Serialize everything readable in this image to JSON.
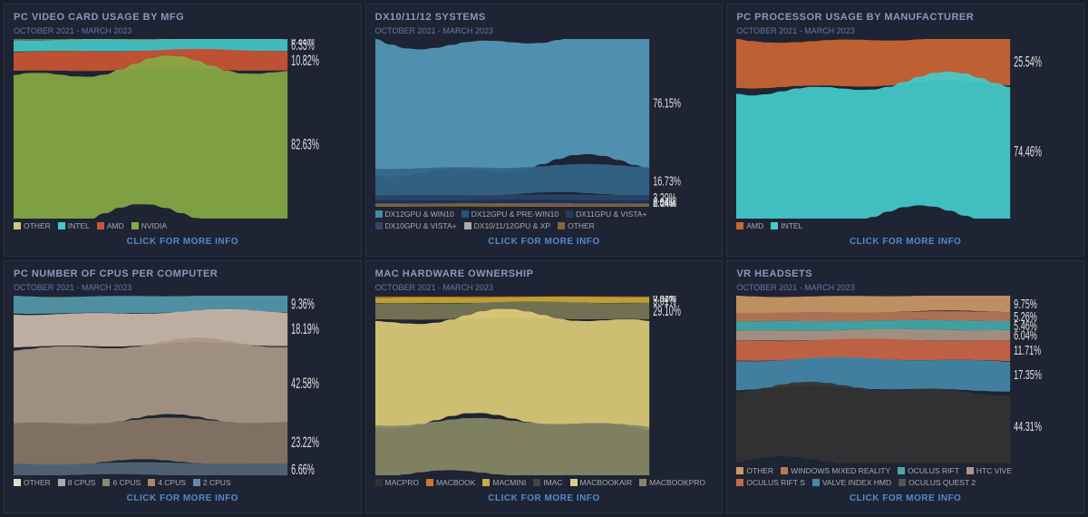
{
  "panels": [
    {
      "id": "pc-video-card",
      "title": "PC VIDEO CARD USAGE BY MFG",
      "period": "OCTOBER 2021 - MARCH 2023",
      "click_label": "CLICK FOR MORE INFO",
      "legend": [
        {
          "label": "OTHER",
          "color": "#d4c878"
        },
        {
          "label": "INTEL",
          "color": "#45c8c8"
        },
        {
          "label": "AMD",
          "color": "#cc5533"
        },
        {
          "label": "NVIDIA",
          "color": "#88aa44"
        }
      ],
      "percentages": [
        "0.22%",
        "6.33%",
        "10.82%",
        "82.63%"
      ],
      "pct_colors": [
        "#d4c878",
        "#45c8c8",
        "#cc5533",
        "#88aa44"
      ],
      "layers": [
        {
          "color": "#d4c878",
          "pct": 0.22
        },
        {
          "color": "#45c8c8",
          "pct": 6.33
        },
        {
          "color": "#cc5533",
          "pct": 10.82
        },
        {
          "color": "#88aa44",
          "pct": 82.63
        }
      ]
    },
    {
      "id": "dx-systems",
      "title": "DX10/11/12 SYSTEMS",
      "period": "OCTOBER 2021 - MARCH 2023",
      "click_label": "CLICK FOR MORE INFO",
      "legend": [
        {
          "label": "DX12GPU & WIN10",
          "color": "#4488aa"
        },
        {
          "label": "DX12GPU & PRE-WIN10",
          "color": "#225577"
        },
        {
          "label": "DX11GPU & VISTA+",
          "color": "#2a3a55"
        },
        {
          "label": "DX10GPU & VISTA+",
          "color": "#334466"
        },
        {
          "label": "DX10/11/12GPU & XP",
          "color": "#aaaaaa"
        },
        {
          "label": "OTHER",
          "color": "#886644"
        }
      ],
      "percentages": [
        "76.15%",
        "16.73%",
        "3.29%",
        "2.04%",
        "0.26%",
        "1.53%"
      ],
      "pct_colors": [
        "#cccccc",
        "#cccccc",
        "#cccccc",
        "#cccccc",
        "#cccccc",
        "#cccccc"
      ],
      "layers": [
        {
          "color": "#5599bb",
          "pct": 76.15
        },
        {
          "color": "#336688",
          "pct": 16.73
        },
        {
          "color": "#2a4466",
          "pct": 3.29
        },
        {
          "color": "#223355",
          "pct": 2.04
        },
        {
          "color": "#cccccc",
          "pct": 0.26
        },
        {
          "color": "#886633",
          "pct": 1.53
        }
      ]
    },
    {
      "id": "pc-processor",
      "title": "PC PROCESSOR USAGE BY MANUFACTURER",
      "period": "OCTOBER 2021 - MARCH 2023",
      "click_label": "CLICK FOR MORE INFO",
      "legend": [
        {
          "label": "AMD",
          "color": "#cc6633"
        },
        {
          "label": "INTEL",
          "color": "#44cccc"
        }
      ],
      "percentages": [
        "25.54%",
        "74.46%"
      ],
      "pct_colors": [
        "#cc6633",
        "#44cccc"
      ],
      "layers": [
        {
          "color": "#cc6633",
          "pct": 25.54
        },
        {
          "color": "#44cccc",
          "pct": 74.46
        }
      ]
    },
    {
      "id": "pc-cpu-count",
      "title": "PC NUMBER OF CPUS PER COMPUTER",
      "period": "OCTOBER 2021 - MARCH 2023",
      "click_label": "CLICK FOR MORE INFO",
      "legend": [
        {
          "label": "OTHER",
          "color": "#ddddcc"
        },
        {
          "label": "8 CPUS",
          "color": "#aaaaaa"
        },
        {
          "label": "6 CPUS",
          "color": "#888877"
        },
        {
          "label": "4 CPUS",
          "color": "#aa8866"
        },
        {
          "label": "2 CPUS",
          "color": "#6688aa"
        }
      ],
      "percentages": [
        "9.36%",
        "18.19%",
        "42.58%",
        "23.22%",
        "6.66%"
      ],
      "pct_colors": [
        "#ddddcc",
        "#aaaaaa",
        "#888877",
        "#aa8866",
        "#6688aa"
      ],
      "layers": [
        {
          "color": "#5599aa",
          "pct": 9.36
        },
        {
          "color": "#ccbbaa",
          "pct": 18.19
        },
        {
          "color": "#aa9988",
          "pct": 42.58
        },
        {
          "color": "#887766",
          "pct": 23.22
        },
        {
          "color": "#556677",
          "pct": 6.66
        }
      ]
    },
    {
      "id": "mac-hardware",
      "title": "MAC HARDWARE OWNERSHIP",
      "period": "OCTOBER 2021 - MARCH 2023",
      "click_label": "CLICK FOR MORE INFO",
      "legend": [
        {
          "label": "MACPRO",
          "color": "#333333"
        },
        {
          "label": "MACBOOK",
          "color": "#cc7733"
        },
        {
          "label": "MACMINI",
          "color": "#ccaa44"
        },
        {
          "label": "IMAC",
          "color": "#444444"
        },
        {
          "label": "MACBOOKAIR",
          "color": "#ddcc88"
        },
        {
          "label": "MACBOOKPRO",
          "color": "#888866"
        }
      ],
      "percentages": [
        "0.43%",
        "0.52%",
        "3.01%",
        "29.10%"
      ],
      "pct_colors": [
        "#cccccc",
        "#cc7733",
        "#ccaa44",
        "#ddcc88"
      ],
      "layers": [
        {
          "color": "#222222",
          "pct": 0.43
        },
        {
          "color": "#cc7733",
          "pct": 0.52
        },
        {
          "color": "#ccaa33",
          "pct": 3.01
        },
        {
          "color": "#777755",
          "pct": 9.0
        },
        {
          "color": "#ddcc77",
          "pct": 57.94
        },
        {
          "color": "#888866",
          "pct": 29.1
        }
      ]
    },
    {
      "id": "vr-headsets",
      "title": "VR HEADSETS",
      "period": "OCTOBER 2021 - MARCH 2023",
      "click_label": "CLICK FOR MORE INFO",
      "legend": [
        {
          "label": "OTHER",
          "color": "#cc9966"
        },
        {
          "label": "WINDOWS MIXED REALITY",
          "color": "#bb7755"
        },
        {
          "label": "OCULUS RIFT",
          "color": "#44aaaa"
        },
        {
          "label": "HTC VIVE",
          "color": "#aa9988"
        },
        {
          "label": "OCULUS RIFT S",
          "color": "#cc6644"
        },
        {
          "label": "VALVE INDEX HMD",
          "color": "#4488aa"
        },
        {
          "label": "OCULUS QUEST 2",
          "color": "#555555"
        }
      ],
      "percentages": [
        "9.75%",
        "5.26%",
        "5.46%",
        "6.04%",
        "11.71%",
        "17.35%",
        "44.31%"
      ],
      "pct_colors": [
        "#cccccc",
        "#cccccc",
        "#cccccc",
        "#cccccc",
        "#cccccc",
        "#cccccc",
        "#cccccc"
      ],
      "layers": [
        {
          "color": "#cc9966",
          "pct": 9.75
        },
        {
          "color": "#bb7755",
          "pct": 5.26
        },
        {
          "color": "#44aaaa",
          "pct": 5.46
        },
        {
          "color": "#aa9988",
          "pct": 6.04
        },
        {
          "color": "#cc6644",
          "pct": 11.71
        },
        {
          "color": "#4488aa",
          "pct": 17.35
        },
        {
          "color": "#333333",
          "pct": 44.43
        }
      ]
    }
  ]
}
